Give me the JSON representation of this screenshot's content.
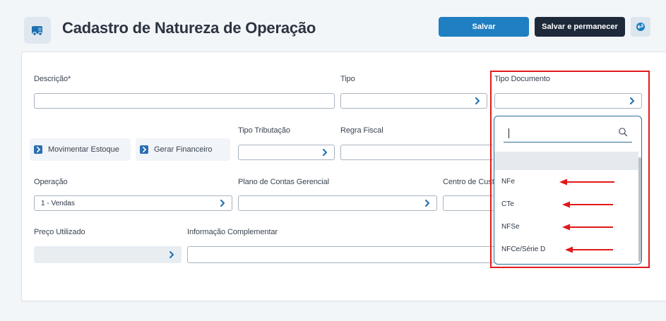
{
  "header": {
    "title": "Cadastro de Natureza de Operação",
    "page_icon": "truck-icon",
    "save_label": "Salvar",
    "save_stay_label": "Salvar e permanecer",
    "back_icon": "undo-icon"
  },
  "form": {
    "descricao": {
      "label": "Descrição*",
      "value": ""
    },
    "tipo": {
      "label": "Tipo",
      "value": ""
    },
    "tipo_documento": {
      "label": "Tipo Documento",
      "value": ""
    },
    "movimentar_estoque": {
      "label": "Movimentar Estoque",
      "checked": true
    },
    "gerar_financeiro": {
      "label": "Gerar Financeiro",
      "checked": true
    },
    "tipo_tributacao": {
      "label": "Tipo Tributação",
      "value": ""
    },
    "regra_fiscal": {
      "label": "Regra Fiscal",
      "value": ""
    },
    "operacao": {
      "label": "Operação",
      "value": "1 - Vendas"
    },
    "plano_contas": {
      "label": "Plano de Contas Gerencial",
      "value": ""
    },
    "centro_custo": {
      "label": "Centro de Custo",
      "value": ""
    },
    "preco_utilizado": {
      "label": "Preço Utilizado",
      "value": ""
    },
    "info_complementar": {
      "label": "Informação Complementar",
      "value": ""
    }
  },
  "dropdown": {
    "search_value": "",
    "search_icon": "search-icon",
    "options": [
      "",
      "NFe",
      "CTe",
      "NFSe",
      "NFCe/Série D"
    ]
  },
  "colors": {
    "primary": "#1f7fc1",
    "dark": "#1e2a3a",
    "annotation": "#e11919"
  }
}
